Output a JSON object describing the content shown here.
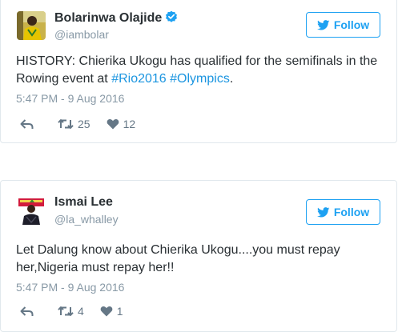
{
  "colors": {
    "accent": "#1da1f2",
    "hashtag": "#1b95e0",
    "verified": "#1da1f2",
    "muted": "#8899a6",
    "text": "#292f33",
    "action": "#657786"
  },
  "tweets": [
    {
      "author_name": "Bolarinwa Olajide",
      "verified": true,
      "verified_icon": "verified-badge-icon",
      "handle": "@iambolar",
      "follow_label": "Follow",
      "follow_icon": "twitter-bird-icon",
      "text_plain": "HISTORY: Chierika Ukogu has qualified for the semifinals in the Rowing event at ",
      "hashtag_1": "#Rio2016",
      "hashtag_2": "#Olympics",
      "text_end": ".",
      "timestamp": "5:47 PM - 9 Aug 2016",
      "reply_icon": "reply-icon",
      "retweet_icon": "retweet-icon",
      "like_icon": "heart-icon",
      "retweets": "25",
      "likes": "12"
    },
    {
      "author_name": "Ismai Lee",
      "verified": false,
      "handle": "@la_whalley",
      "follow_label": "Follow",
      "follow_icon": "twitter-bird-icon",
      "text": "Let Dalung know about Chierika Ukogu....you must repay her,Nigeria must repay her!!",
      "timestamp": "5:47 PM - 9 Aug 2016",
      "reply_icon": "reply-icon",
      "retweet_icon": "retweet-icon",
      "like_icon": "heart-icon",
      "retweets": "4",
      "likes": "1"
    }
  ]
}
